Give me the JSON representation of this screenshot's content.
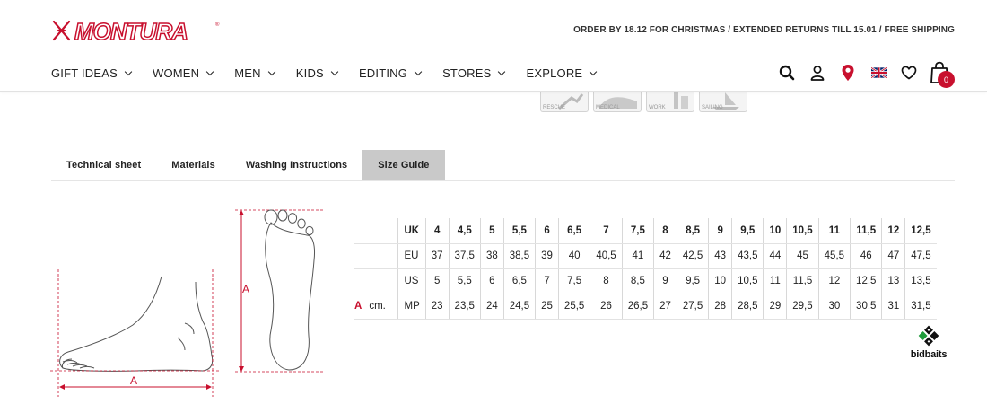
{
  "brand": {
    "logo_text": "MONTURA",
    "accent": "#c8102e"
  },
  "promo": {
    "text": "ORDER BY 18.12 FOR CHRISTMAS / EXTENDED RETURNS TILL 15.01 / FREE SHIPPING"
  },
  "nav": {
    "items": [
      {
        "label": "GIFT IDEAS"
      },
      {
        "label": "WOMEN"
      },
      {
        "label": "MEN"
      },
      {
        "label": "KIDS"
      },
      {
        "label": "EDITING"
      },
      {
        "label": "STORES"
      },
      {
        "label": "EXPLORE"
      }
    ]
  },
  "tools": {
    "icons": [
      "search-icon",
      "user-icon",
      "location-pin-icon",
      "uk-flag-icon",
      "heart-icon",
      "shopping-bag-icon"
    ],
    "cart_count": "0"
  },
  "activities": [
    "RESCUE",
    "MEDICAL",
    "WORK",
    "SAILING"
  ],
  "tabs": [
    {
      "label": "Technical sheet",
      "active": false
    },
    {
      "label": "Materials",
      "active": false
    },
    {
      "label": "Washing Instructions",
      "active": false
    },
    {
      "label": "Size Guide",
      "active": true
    }
  ],
  "diagram": {
    "dimension_label": "A"
  },
  "size_table": {
    "rows": [
      {
        "lead_a": "",
        "lead_unit": "",
        "label": "UK",
        "values": [
          "4",
          "4,5",
          "5",
          "5,5",
          "6",
          "6,5",
          "7",
          "7,5",
          "8",
          "8,5",
          "9",
          "9,5",
          "10",
          "10,5",
          "11",
          "11,5",
          "12",
          "12,5"
        ]
      },
      {
        "lead_a": "",
        "lead_unit": "",
        "label": "EU",
        "values": [
          "37",
          "37,5",
          "38",
          "38,5",
          "39",
          "40",
          "40,5",
          "41",
          "42",
          "42,5",
          "43",
          "43,5",
          "44",
          "45",
          "45,5",
          "46",
          "47",
          "47,5"
        ]
      },
      {
        "lead_a": "",
        "lead_unit": "",
        "label": "US",
        "values": [
          "5",
          "5,5",
          "6",
          "6,5",
          "7",
          "7,5",
          "8",
          "8,5",
          "9",
          "9,5",
          "10",
          "10,5",
          "11",
          "11,5",
          "12",
          "12,5",
          "13",
          "13,5"
        ]
      },
      {
        "lead_a": "A",
        "lead_unit": "cm.",
        "label": "MP",
        "values": [
          "23",
          "23,5",
          "24",
          "24,5",
          "25",
          "25,5",
          "26",
          "26,5",
          "27",
          "27,5",
          "28",
          "28,5",
          "29",
          "29,5",
          "30",
          "30,5",
          "31",
          "31,5"
        ]
      }
    ]
  },
  "badge": {
    "text": "bidbaits"
  }
}
